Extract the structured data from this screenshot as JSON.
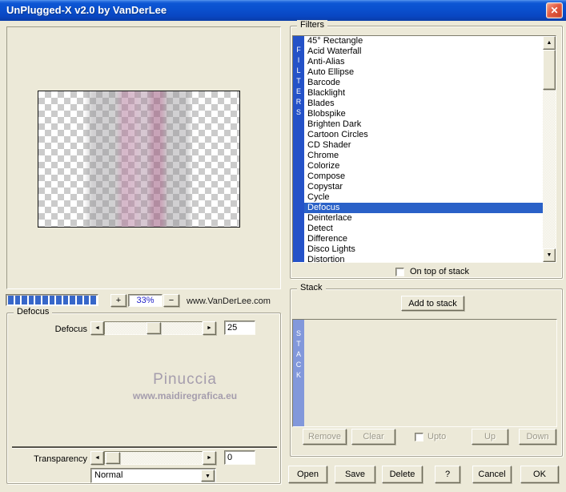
{
  "window": {
    "title": "UnPlugged-X v2.0 by VanDerLee"
  },
  "icons": {
    "close": "✕",
    "arrow_left": "◄",
    "arrow_right": "►",
    "arrow_up": "▲",
    "arrow_down": "▼"
  },
  "preview": {
    "progress_segments": 13,
    "zoom_in_label": "+",
    "zoom_level": "33%",
    "zoom_out_label": "−",
    "website": "www.VanDerLee.com"
  },
  "filters": {
    "group_label": "Filters",
    "vertical_label": "FILTERS",
    "items": [
      "45° Rectangle",
      "Acid Waterfall",
      "Anti-Alias",
      "Auto Ellipse",
      "Barcode",
      "Blacklight",
      "Blades",
      "Blobspike",
      "Brighten Dark",
      "Cartoon Circles",
      "CD Shader",
      "Chrome",
      "Colorize",
      "Compose",
      "Copystar",
      "Cycle",
      "Defocus",
      "Deinterlace",
      "Detect",
      "Difference",
      "Disco Lights",
      "Distortion"
    ],
    "selected_index": 16,
    "selected_item": "Defocus",
    "on_top_label": "On top of stack",
    "on_top_checked": false
  },
  "defocus_panel": {
    "group_label": "Defocus",
    "slider_label": "Defocus",
    "slider_value": "25",
    "transparency_label": "Transparency",
    "transparency_value": "0",
    "blend_mode": "Normal",
    "watermark_title": "Pinuccia",
    "watermark_url": "www.maidiregrafica.eu"
  },
  "stack": {
    "group_label": "Stack",
    "vertical_label": "STACK",
    "add_button": "Add to stack",
    "remove_button": "Remove",
    "clear_button": "Clear",
    "upto_label": "Upto",
    "upto_checked": false,
    "up_button": "Up",
    "down_button": "Down",
    "items": []
  },
  "footer": {
    "open": "Open",
    "save": "Save",
    "delete": "Delete",
    "help": "?",
    "cancel": "Cancel",
    "ok": "OK"
  },
  "colors": {
    "dialog_bg": "#ECE9D8",
    "titlebar_mid": "#0A50CE",
    "close_red": "#C83C22",
    "selection_blue": "#2A61C8",
    "filters_bar_blue": "#2452C8",
    "stack_bar_blue": "#8298DB",
    "progress_blue": "#3767C9",
    "zoom_text_blue": "#2323C8",
    "watermark_gray": "#A59DAD",
    "list_bg": "#FFFFFF"
  }
}
